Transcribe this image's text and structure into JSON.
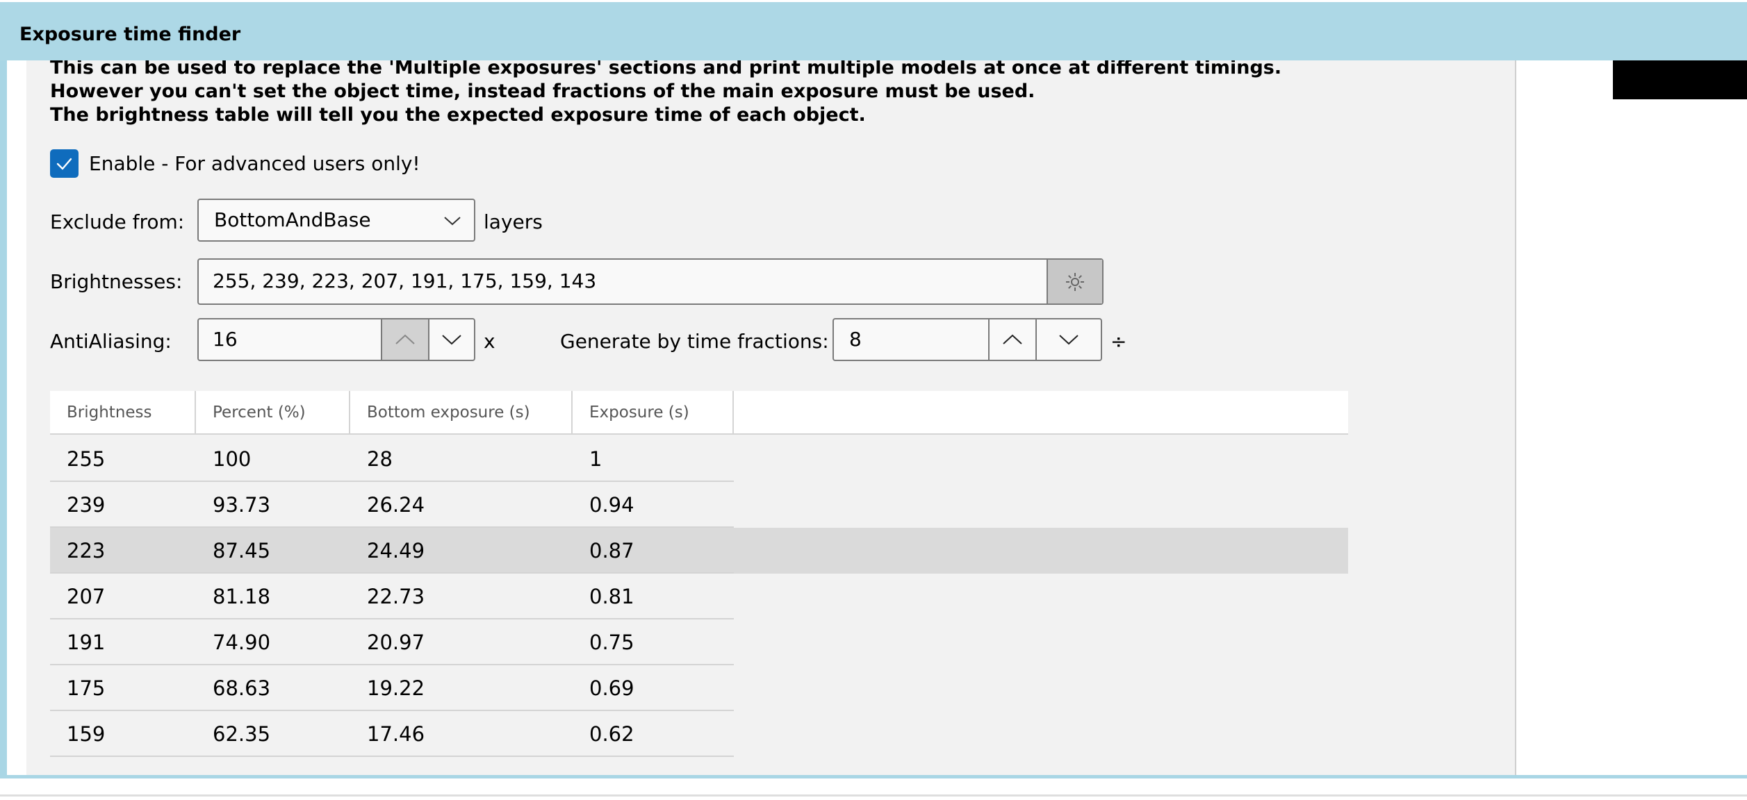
{
  "window": {
    "title": "Exposure time finder"
  },
  "description": {
    "line1": "This can be used to replace the 'Multiple exposures' sections and print multiple models at once at different timings.",
    "line2": "However you can't set the object time, instead fractions of the main exposure must be used.",
    "line3": "The brightness table will tell you the expected exposure time of each object."
  },
  "enable": {
    "checked": true,
    "label": "Enable - For advanced users only!"
  },
  "exclude": {
    "label": "Exclude from:",
    "value": "BottomAndBase",
    "suffix": "layers"
  },
  "brightnesses": {
    "label": "Brightnesses:",
    "value": "255, 239, 223, 207, 191, 175, 159, 143"
  },
  "antialiasing": {
    "label": "AntiAliasing:",
    "value": "16",
    "suffix": "x"
  },
  "time_fractions": {
    "label": "Generate by time fractions:",
    "value": "8",
    "suffix": "÷"
  },
  "table": {
    "columns": [
      "Brightness",
      "Percent (%)",
      "Bottom exposure (s)",
      "Exposure (s)"
    ],
    "rows": [
      [
        "255",
        "100",
        "28",
        "1"
      ],
      [
        "239",
        "93.73",
        "26.24",
        "0.94"
      ],
      [
        "223",
        "87.45",
        "24.49",
        "0.87"
      ],
      [
        "207",
        "81.18",
        "22.73",
        "0.81"
      ],
      [
        "191",
        "74.90",
        "20.97",
        "0.75"
      ],
      [
        "175",
        "68.63",
        "19.22",
        "0.69"
      ],
      [
        "159",
        "62.35",
        "17.46",
        "0.62"
      ]
    ],
    "selected_row": 2
  },
  "colors": {
    "accent": "#0f6cbd",
    "titlebar": "#add8e6",
    "panel": "#f2f2f2",
    "selected_row": "#dadada"
  }
}
